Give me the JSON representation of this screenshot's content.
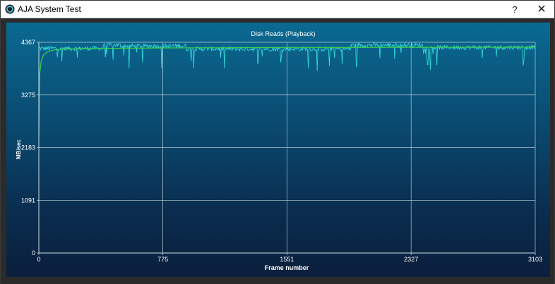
{
  "window": {
    "title": "AJA System Test",
    "help_label": "?",
    "close_label": "✕",
    "app_icon": "aja-logo-icon",
    "help_icon": "question-mark-icon",
    "close_icon": "close-icon"
  },
  "colors": {
    "panel_top": "#0a6a92",
    "panel_bottom": "#0a1f3c",
    "grid": "#b8cbd8",
    "trace": "#36e0dc",
    "average": "#3fcf4a",
    "text": "#ffffff"
  },
  "chart_data": {
    "type": "line",
    "title": "Disk Reads (Playback)",
    "xlabel": "Frame number",
    "ylabel": "MB/sec",
    "xlim": [
      0,
      3103
    ],
    "ylim": [
      0,
      4367
    ],
    "xticks": [
      0,
      775,
      1551,
      2327,
      3103
    ],
    "yticks": [
      0,
      1091,
      2183,
      3275,
      4367
    ],
    "grid": true,
    "series": [
      {
        "role": "instantaneous",
        "color": "#36e0dc",
        "baseline_segments": [
          {
            "x": [
              0,
              400
            ],
            "y": 4240
          },
          {
            "x": [
              400,
              510
            ],
            "y": 4310
          },
          {
            "x": [
              510,
              920
            ],
            "y": 4290
          },
          {
            "x": [
              920,
              1950
            ],
            "y": 4230
          },
          {
            "x": [
              1950,
              2400
            ],
            "y": 4310
          },
          {
            "x": [
              2400,
              3103
            ],
            "y": 4260
          }
        ]
      },
      {
        "role": "average",
        "color": "#3fcf4a",
        "x": [
          0,
          5,
          15,
          30,
          60,
          100,
          200,
          400,
          800,
          1600,
          3103
        ],
        "y": [
          2400,
          3700,
          3980,
          4110,
          4180,
          4210,
          4230,
          4240,
          4250,
          4260,
          4265
        ]
      }
    ]
  }
}
